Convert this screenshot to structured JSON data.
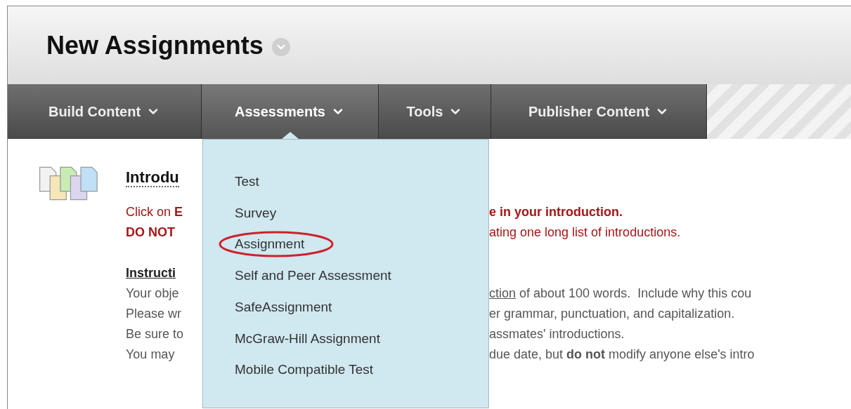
{
  "page": {
    "title": "New Assignments"
  },
  "nav": {
    "tabs": [
      {
        "label": "Build Content",
        "selected": false
      },
      {
        "label": "Assessments",
        "selected": true
      },
      {
        "label": "Tools",
        "selected": false
      },
      {
        "label": "Publisher Content",
        "selected": false
      }
    ]
  },
  "menu": {
    "items": [
      {
        "label": "Test",
        "circled": false
      },
      {
        "label": "Survey",
        "circled": false
      },
      {
        "label": "Assignment",
        "circled": true
      },
      {
        "label": "Self and Peer Assessment",
        "circled": false
      },
      {
        "label": "SafeAssignment",
        "circled": false
      },
      {
        "label": "McGraw-Hill Assignment",
        "circled": false
      },
      {
        "label": "Mobile Compatible Test",
        "circled": false
      }
    ]
  },
  "content": {
    "title": "Introdu",
    "lines": [
      {
        "kind": "alert",
        "left": "Click on **E**",
        "right": "**e in your introduction.**"
      },
      {
        "kind": "alert",
        "left": "**DO NOT**",
        "right": "ating one long list of introductions."
      },
      {
        "kind": "blank"
      },
      {
        "kind": "heading",
        "left": "Instructi"
      },
      {
        "kind": "body",
        "left": "Your obje",
        "link": "ction",
        "right": " of about 100 words.  Include why this cou"
      },
      {
        "kind": "body",
        "left": "Please wr",
        "right": "er grammar, punctuation, and capitalization."
      },
      {
        "kind": "body",
        "left": "Be sure to",
        "right": "assmates' introductions."
      },
      {
        "kind": "body",
        "left": "You may",
        "right": "due date, but **do not** modify anyone else's intro"
      }
    ]
  }
}
